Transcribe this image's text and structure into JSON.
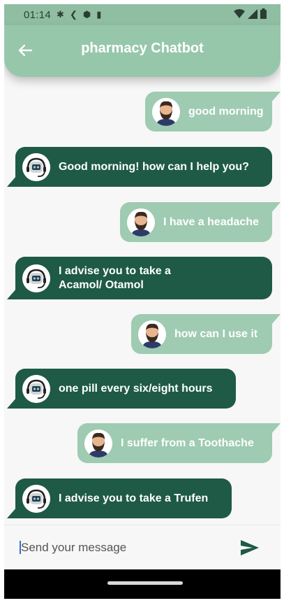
{
  "status_bar": {
    "time": "01:14",
    "icons": [
      "gear-icon",
      "flutter-icon",
      "shield-icon",
      "sim-card-icon"
    ],
    "right_icons": [
      "wifi-icon",
      "signal-icon",
      "battery-icon"
    ]
  },
  "app_bar": {
    "title": "pharmacy Chatbot",
    "background": "#97c7ab"
  },
  "colors": {
    "user_bubble": "#9ecbb1",
    "bot_bubble": "#1e5a46",
    "send_icon": "#1e5a46"
  },
  "messages": [
    {
      "sender": "user",
      "text": "good morning"
    },
    {
      "sender": "bot",
      "text": "Good morning! how can I help you?"
    },
    {
      "sender": "user",
      "text": "I have a headache"
    },
    {
      "sender": "bot",
      "text": "I advise you to take a Acamol/ Otamol"
    },
    {
      "sender": "user",
      "text": "how can I use it"
    },
    {
      "sender": "bot",
      "text": "one pill every six/eight hours"
    },
    {
      "sender": "user",
      "text": "I suffer from a Toothache"
    },
    {
      "sender": "bot",
      "text": "I advise you to take a Trufen"
    }
  ],
  "input": {
    "placeholder": "Send your message",
    "value": ""
  }
}
